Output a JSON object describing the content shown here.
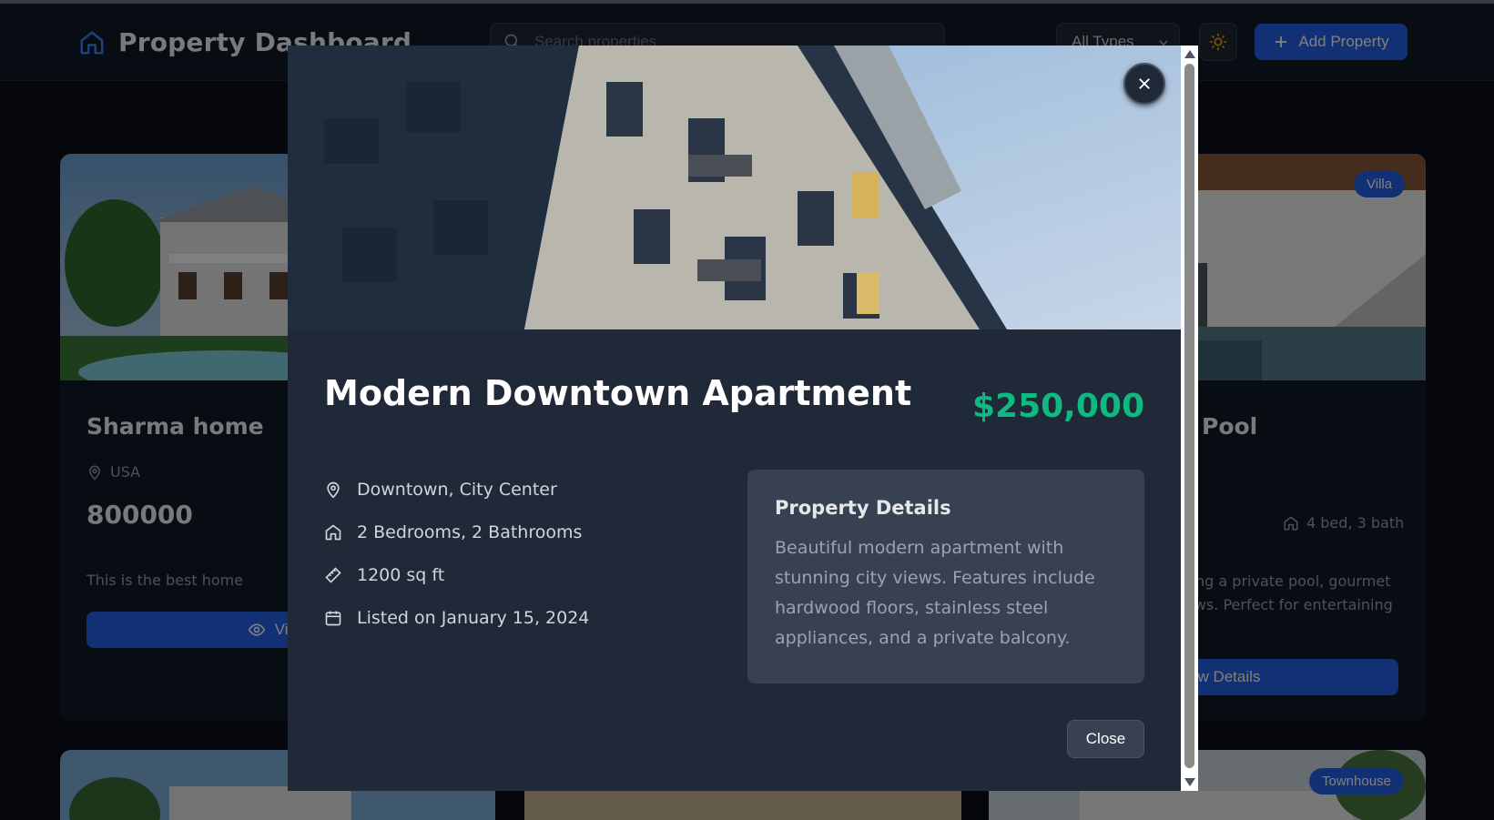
{
  "header": {
    "title": "Property Dashboard",
    "search_placeholder": "Search properties",
    "type_filter": "All Types",
    "add_label": "Add Property"
  },
  "cards": {
    "left": {
      "name": "Sharma home",
      "location": "USA",
      "price": "800000",
      "description": "This is the best home",
      "button": "View"
    },
    "right": {
      "name_fragment": "Pool",
      "badge": "Villa",
      "beds": "4 bed, 3 bath",
      "description_line1": "ring a private pool, gourmet",
      "description_line2": "ews. Perfect for entertaining",
      "button": "ew Details"
    },
    "bottom_right_badge": "Townhouse"
  },
  "modal": {
    "title": "Modern Downtown Apartment",
    "price": "$250,000",
    "facts": [
      {
        "icon": "map-pin-icon",
        "text": "Downtown, City Center"
      },
      {
        "icon": "home-icon",
        "text": "2 Bedrooms, 2 Bathrooms"
      },
      {
        "icon": "ruler-icon",
        "text": "1200 sq ft"
      },
      {
        "icon": "calendar-icon",
        "text": "Listed on January 15, 2024"
      }
    ],
    "details_heading": "Property Details",
    "details_text": "Beautiful modern apartment with stunning city views. Features include hardwood floors, stainless steel appliances, and a private balcony.",
    "close_label": "Close"
  },
  "colors": {
    "accent": "#2563eb",
    "price": "#10b981",
    "modal_bg": "#1f2937",
    "page_bg": "#0b0f19"
  }
}
